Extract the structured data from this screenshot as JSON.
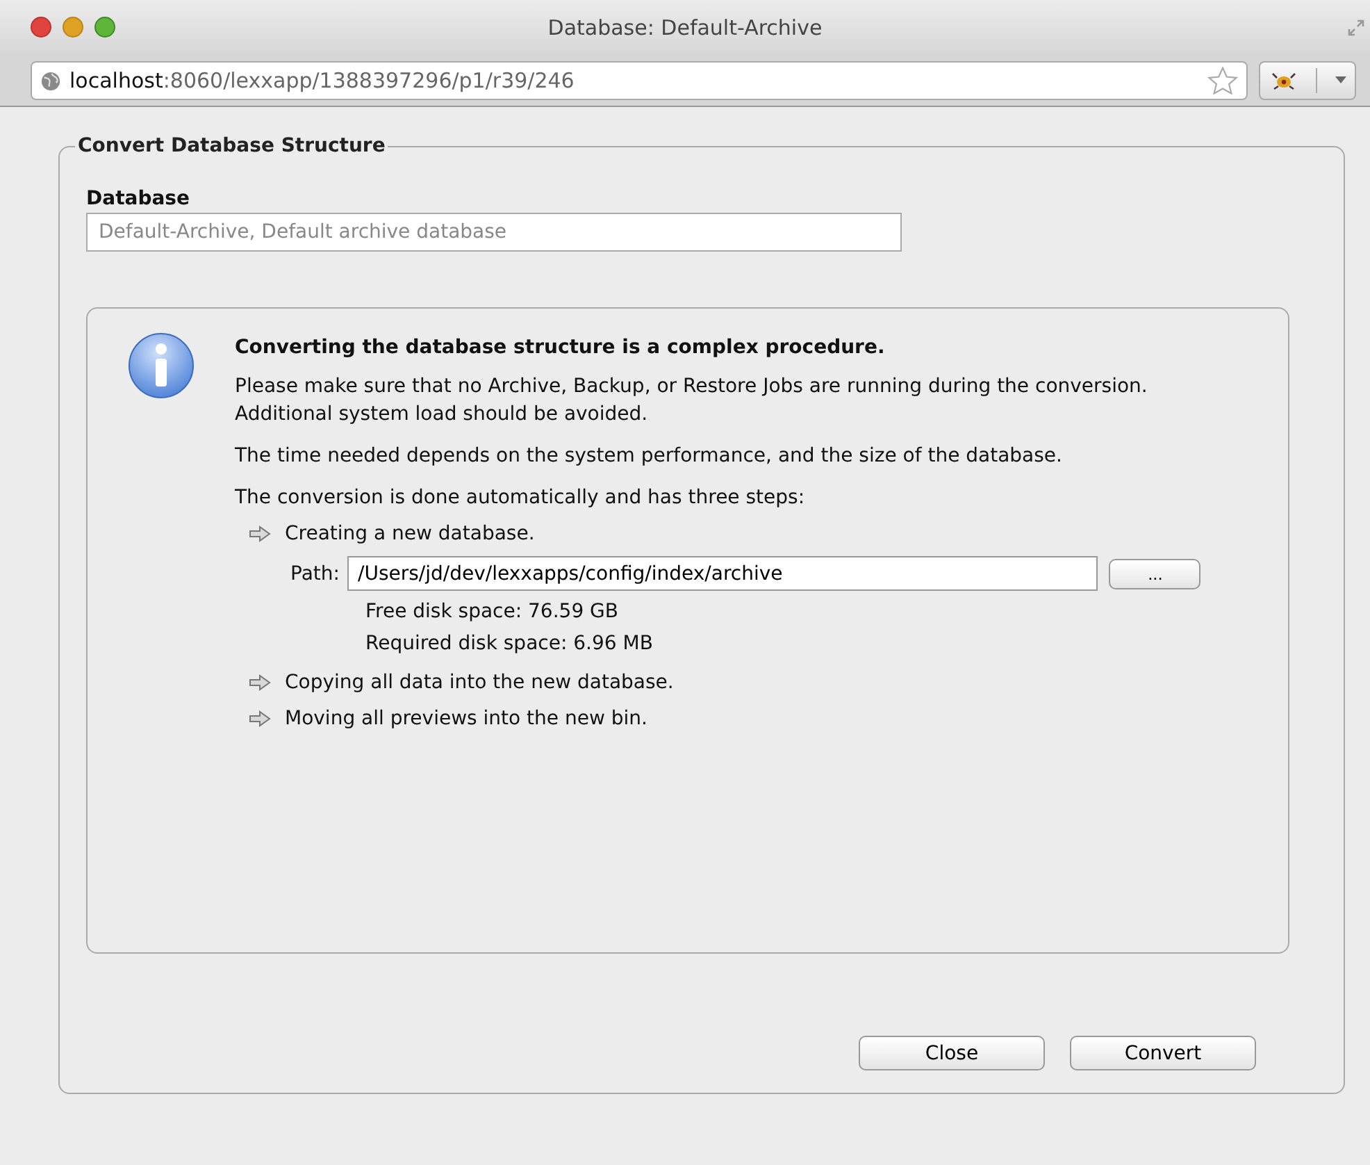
{
  "window": {
    "title": "Database: Default-Archive"
  },
  "address_bar": {
    "url": "**localhost**:8060/lexxapp/1388397296/p1/r39/246"
  },
  "form": {
    "legend": "Convert Database Structure",
    "database_label": "Database",
    "database_placeholder": "Default-Archive, Default archive database"
  },
  "info": {
    "heading": "Converting the database structure is a complex procedure.",
    "paragraphs": [
      "Please make sure that no Archive, Backup, or Restore Jobs are running during the conversion. Additional system load should be avoided.",
      "The time needed depends on the system performance, and the size of the database.",
      "The conversion is done automatically and has three steps:"
    ],
    "steps": [
      {
        "text": "Creating a new database.",
        "path_label": "Path:",
        "path_value": "/Users/jd/dev/lexxapps/config/index/archive",
        "browse_button": "...",
        "details": [
          "Free disk space:  76.59 GB",
          "Required disk space:  6.96 MB"
        ]
      },
      {
        "text": "Copying all data into the new database."
      },
      {
        "text": "Moving all previews into the new bin."
      }
    ]
  },
  "buttons": [
    "Close",
    "Convert"
  ]
}
